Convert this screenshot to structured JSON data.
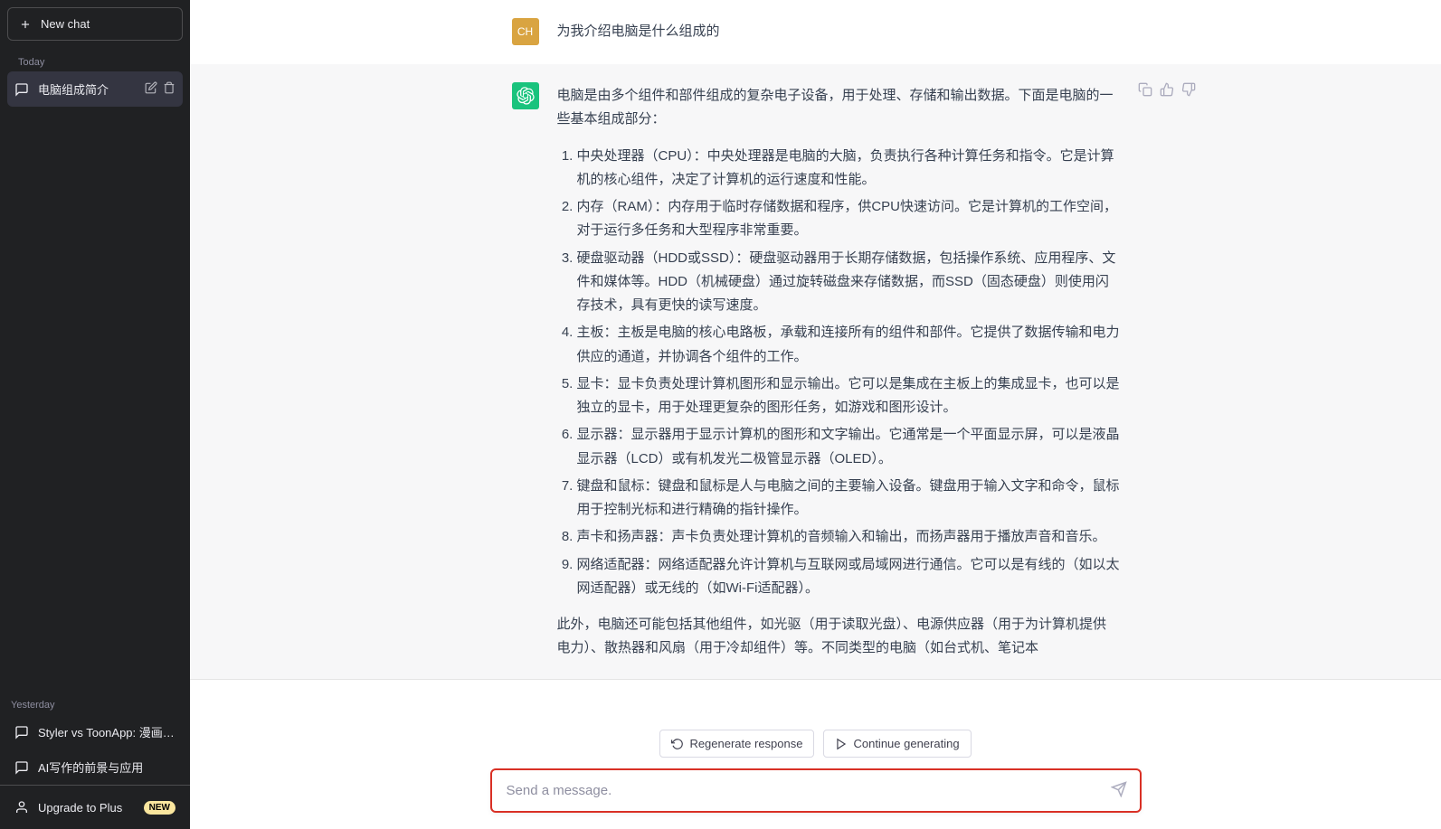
{
  "sidebar": {
    "new_chat_label": "New chat",
    "today_label": "Today",
    "yesterday_label": "Yesterday",
    "today_items": [
      {
        "label": "电脑组成简介",
        "active": true
      }
    ],
    "yesterday_items": [
      {
        "label": "Styler vs ToonApp: 漫画脸优劣"
      },
      {
        "label": "AI写作的前景与应用"
      }
    ],
    "upgrade_label": "Upgrade to Plus",
    "upgrade_badge": "NEW"
  },
  "conversation": {
    "user_avatar": "CH",
    "user_message": "为我介绍电脑是什么组成的",
    "assistant_intro": "电脑是由多个组件和部件组成的复杂电子设备，用于处理、存储和输出数据。下面是电脑的一些基本组成部分：",
    "assistant_list": [
      "中央处理器（CPU）：中央处理器是电脑的大脑，负责执行各种计算任务和指令。它是计算机的核心组件，决定了计算机的运行速度和性能。",
      "内存（RAM）：内存用于临时存储数据和程序，供CPU快速访问。它是计算机的工作空间，对于运行多任务和大型程序非常重要。",
      "硬盘驱动器（HDD或SSD）：硬盘驱动器用于长期存储数据，包括操作系统、应用程序、文件和媒体等。HDD（机械硬盘）通过旋转磁盘来存储数据，而SSD（固态硬盘）则使用闪存技术，具有更快的读写速度。",
      "主板：主板是电脑的核心电路板，承载和连接所有的组件和部件。它提供了数据传输和电力供应的通道，并协调各个组件的工作。",
      "显卡：显卡负责处理计算机图形和显示输出。它可以是集成在主板上的集成显卡，也可以是独立的显卡，用于处理更复杂的图形任务，如游戏和图形设计。",
      "显示器：显示器用于显示计算机的图形和文字输出。它通常是一个平面显示屏，可以是液晶显示器（LCD）或有机发光二极管显示器（OLED）。",
      "键盘和鼠标：键盘和鼠标是人与电脑之间的主要输入设备。键盘用于输入文字和命令，鼠标用于控制光标和进行精确的指针操作。",
      "声卡和扬声器：声卡负责处理计算机的音频输入和输出，而扬声器用于播放声音和音乐。",
      "网络适配器：网络适配器允许计算机与互联网或局域网进行通信。它可以是有线的（如以太网适配器）或无线的（如Wi-Fi适配器）。"
    ],
    "assistant_outro": "此外，电脑还可能包括其他组件，如光驱（用于读取光盘）、电源供应器（用于为计算机提供电力）、散热器和风扇（用于冷却组件）等。不同类型的电脑（如台式机、笔记本"
  },
  "controls": {
    "regenerate_label": "Regenerate response",
    "continue_label": "Continue generating",
    "input_placeholder": "Send a message."
  }
}
